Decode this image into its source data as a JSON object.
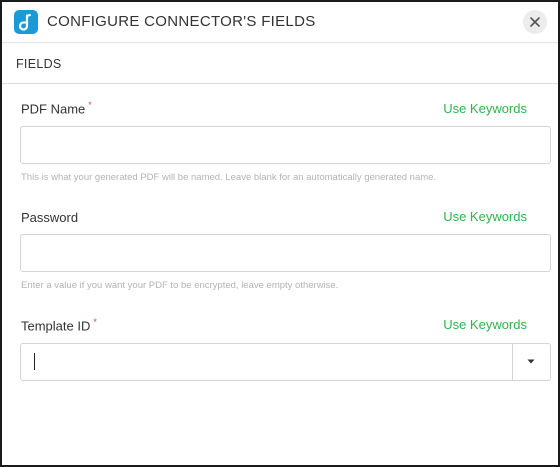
{
  "header": {
    "title": "CONFIGURE CONNECTOR'S FIELDS",
    "logo_icon": "document-app-icon",
    "close_icon": "close-icon"
  },
  "section": {
    "label": "FIELDS"
  },
  "fields": [
    {
      "label": "PDF Name",
      "required_mark": "*",
      "keywords_link": "Use Keywords",
      "value": "",
      "placeholder": "",
      "hint": "This is what your generated PDF will be named. Leave blank for an automatically generated name."
    },
    {
      "label": "Password",
      "keywords_link": "Use Keywords",
      "value": "",
      "placeholder": "",
      "hint": "Enter a value if you want your PDF to be encrypted, leave empty otherwise."
    },
    {
      "label": "Template ID",
      "required_mark": "*",
      "keywords_link": "Use Keywords",
      "value": "",
      "placeholder": "",
      "dropdown_icon": "caret-down-icon"
    }
  ],
  "colors": {
    "accent_green": "#2fb34a",
    "logo_blue": "#1a9bd7",
    "required_red": "#e0474c"
  }
}
